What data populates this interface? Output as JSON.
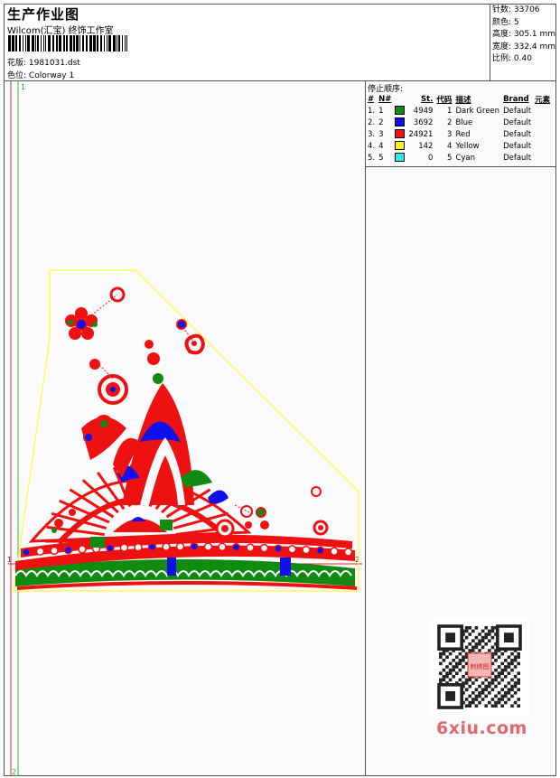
{
  "header": {
    "title": "生产作业图",
    "studio": "Wilcom(汇宝) 终饰工作室",
    "design_label": "花版:",
    "design_value": "1981031.dst",
    "colorway_label": "色位:",
    "colorway_value": "Colorway 1"
  },
  "stats": {
    "stitches": "针数: 33706",
    "colors": "颜色: 5",
    "height": "高度: 305.1 mm",
    "width": "宽度: 332.4 mm",
    "scale": "比例: 0.40"
  },
  "stop_sequence": {
    "title": "停止顺序:",
    "headers": [
      "#",
      "N#",
      "",
      "St.",
      "代码",
      "描述",
      "Brand",
      "元素"
    ],
    "rows": [
      {
        "idx": "1. 1",
        "color": "#118a11",
        "st": "4949",
        "code": "1",
        "desc": "Dark Green",
        "brand": "Default"
      },
      {
        "idx": "2. 2",
        "color": "#1010ee",
        "st": "3692",
        "code": "2",
        "desc": "Blue",
        "brand": "Default"
      },
      {
        "idx": "3. 3",
        "color": "#ee1111",
        "st": "24921",
        "code": "3",
        "desc": "Red",
        "brand": "Default"
      },
      {
        "idx": "4. 4",
        "color": "#ffff00",
        "st": "142",
        "code": "4",
        "desc": "Yellow",
        "brand": "Default"
      },
      {
        "idx": "5. 5",
        "color": "#22eeee",
        "st": "0",
        "code": "5",
        "desc": "Cyan",
        "brand": "Default"
      }
    ]
  },
  "canvas": {
    "markers": {
      "top": "1",
      "bottom": "2",
      "left_mid": "1",
      "right_mid": "2"
    },
    "colors": {
      "red": "#ee1111",
      "blue": "#1010ee",
      "green": "#118a11",
      "yellow": "#ffff00"
    }
  },
  "watermark": {
    "site": "6xiu.com",
    "stamp": "刺绣图"
  }
}
